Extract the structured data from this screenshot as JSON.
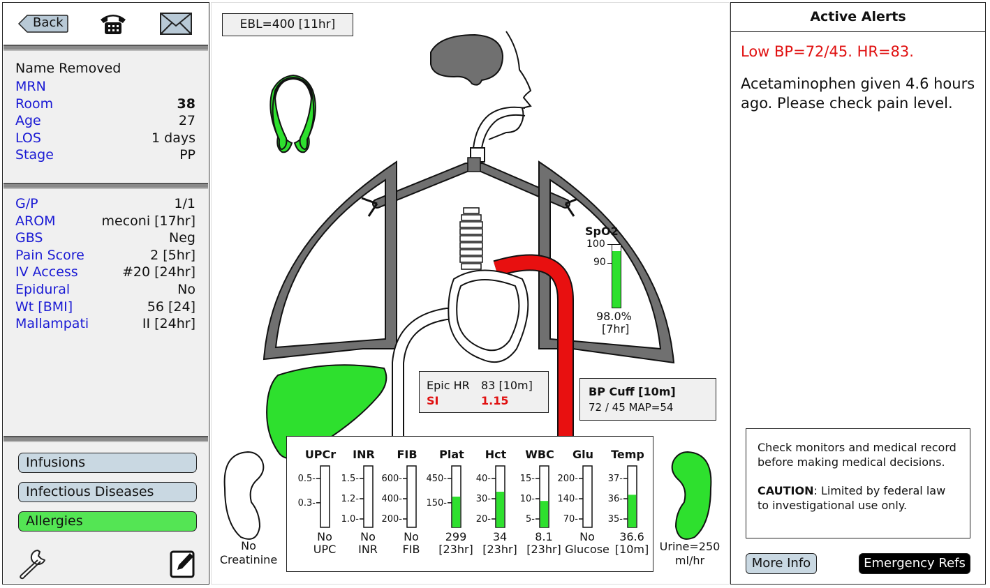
{
  "toolbar": {
    "back_label": "Back"
  },
  "patient": {
    "name": "Name Removed",
    "mrn_label": "MRN",
    "mrn_value": "",
    "room_label": "Room",
    "room_value": "38",
    "age_label": "Age",
    "age_value": "27",
    "los_label": "LOS",
    "los_value": "1 days",
    "stage_label": "Stage",
    "stage_value": "PP"
  },
  "details": [
    {
      "label": "G/P",
      "value": "1/1"
    },
    {
      "label": "AROM",
      "value": "meconi [17hr]"
    },
    {
      "label": "GBS",
      "value": "Neg"
    },
    {
      "label": "Pain Score",
      "value": "2 [5hr]"
    },
    {
      "label": "IV Access",
      "value": "#20 [24hr]"
    },
    {
      "label": "Epidural",
      "value": "No"
    },
    {
      "label": "Wt [BMI]",
      "value": "56 [24]"
    },
    {
      "label": "Mallampati",
      "value": "II [24hr]"
    }
  ],
  "buttons": {
    "infusions": "Infusions",
    "infectious": "Infectious Diseases",
    "allergies": "Allergies"
  },
  "ebl": "EBL=400 [11hr]",
  "spo2": {
    "title": "SpO2",
    "tick_100": "100",
    "tick_90": "90",
    "value_text": "98.0%",
    "time_text": "[7hr]",
    "level": 0.98
  },
  "hr_box": {
    "epic_label": "Epic HR",
    "epic_value": "83 [10m]",
    "si_label": "SI",
    "si_value": "1.15"
  },
  "bp_box": {
    "title": "BP Cuff [10m]",
    "value": "72 / 45 MAP=54"
  },
  "kidney_left": {
    "line1": "No",
    "line2": "Creatinine"
  },
  "kidney_right": {
    "line1": "Urine=250",
    "line2": "ml/hr"
  },
  "labs": [
    {
      "header": "UPCr",
      "ticks": [
        "0.5",
        "0.3"
      ],
      "fill": 0,
      "line1": "No",
      "line2": "UPC"
    },
    {
      "header": "INR",
      "ticks": [
        "1.5",
        "1.2",
        "1.0"
      ],
      "fill": 0,
      "line1": "No",
      "line2": "INR"
    },
    {
      "header": "FIB",
      "ticks": [
        "600",
        "400",
        "200"
      ],
      "fill": 0,
      "line1": "No",
      "line2": "FIB"
    },
    {
      "header": "Plat",
      "ticks": [
        "450",
        "150"
      ],
      "fill": 0.5,
      "line1": "299",
      "line2": "[23hr]"
    },
    {
      "header": "Hct",
      "ticks": [
        "40",
        "30",
        "20"
      ],
      "fill": 0.58,
      "line1": "34",
      "line2": "[23hr]"
    },
    {
      "header": "WBC",
      "ticks": [
        "15",
        "10",
        "5"
      ],
      "fill": 0.43,
      "line1": "8.1",
      "line2": "[23hr]"
    },
    {
      "header": "Glu",
      "ticks": [
        "200",
        "140",
        "70"
      ],
      "fill": 0,
      "line1": "No",
      "line2": "Glucose"
    },
    {
      "header": "Temp",
      "ticks": [
        "37",
        "36",
        "35"
      ],
      "fill": 0.53,
      "line1": "36.6",
      "line2": "[10m]"
    }
  ],
  "alerts": {
    "title": "Active Alerts",
    "critical": "Low BP=72/45. HR=83.",
    "message": "Acetaminophen given 4.6 hours ago. Please check pain level."
  },
  "disclaimer": {
    "text": "Check monitors and medical record before making medical decisions.",
    "caution_label": "CAUTION",
    "caution_text": ": Limited by federal law to investigational use only."
  },
  "footer_buttons": {
    "more_info": "More Info",
    "emergency": "Emergency Refs"
  },
  "colors": {
    "link": "#1a1ad4",
    "green": "#2ee02e",
    "alert_red": "#e01010",
    "artery": "#e81010",
    "brain": "#707070"
  }
}
